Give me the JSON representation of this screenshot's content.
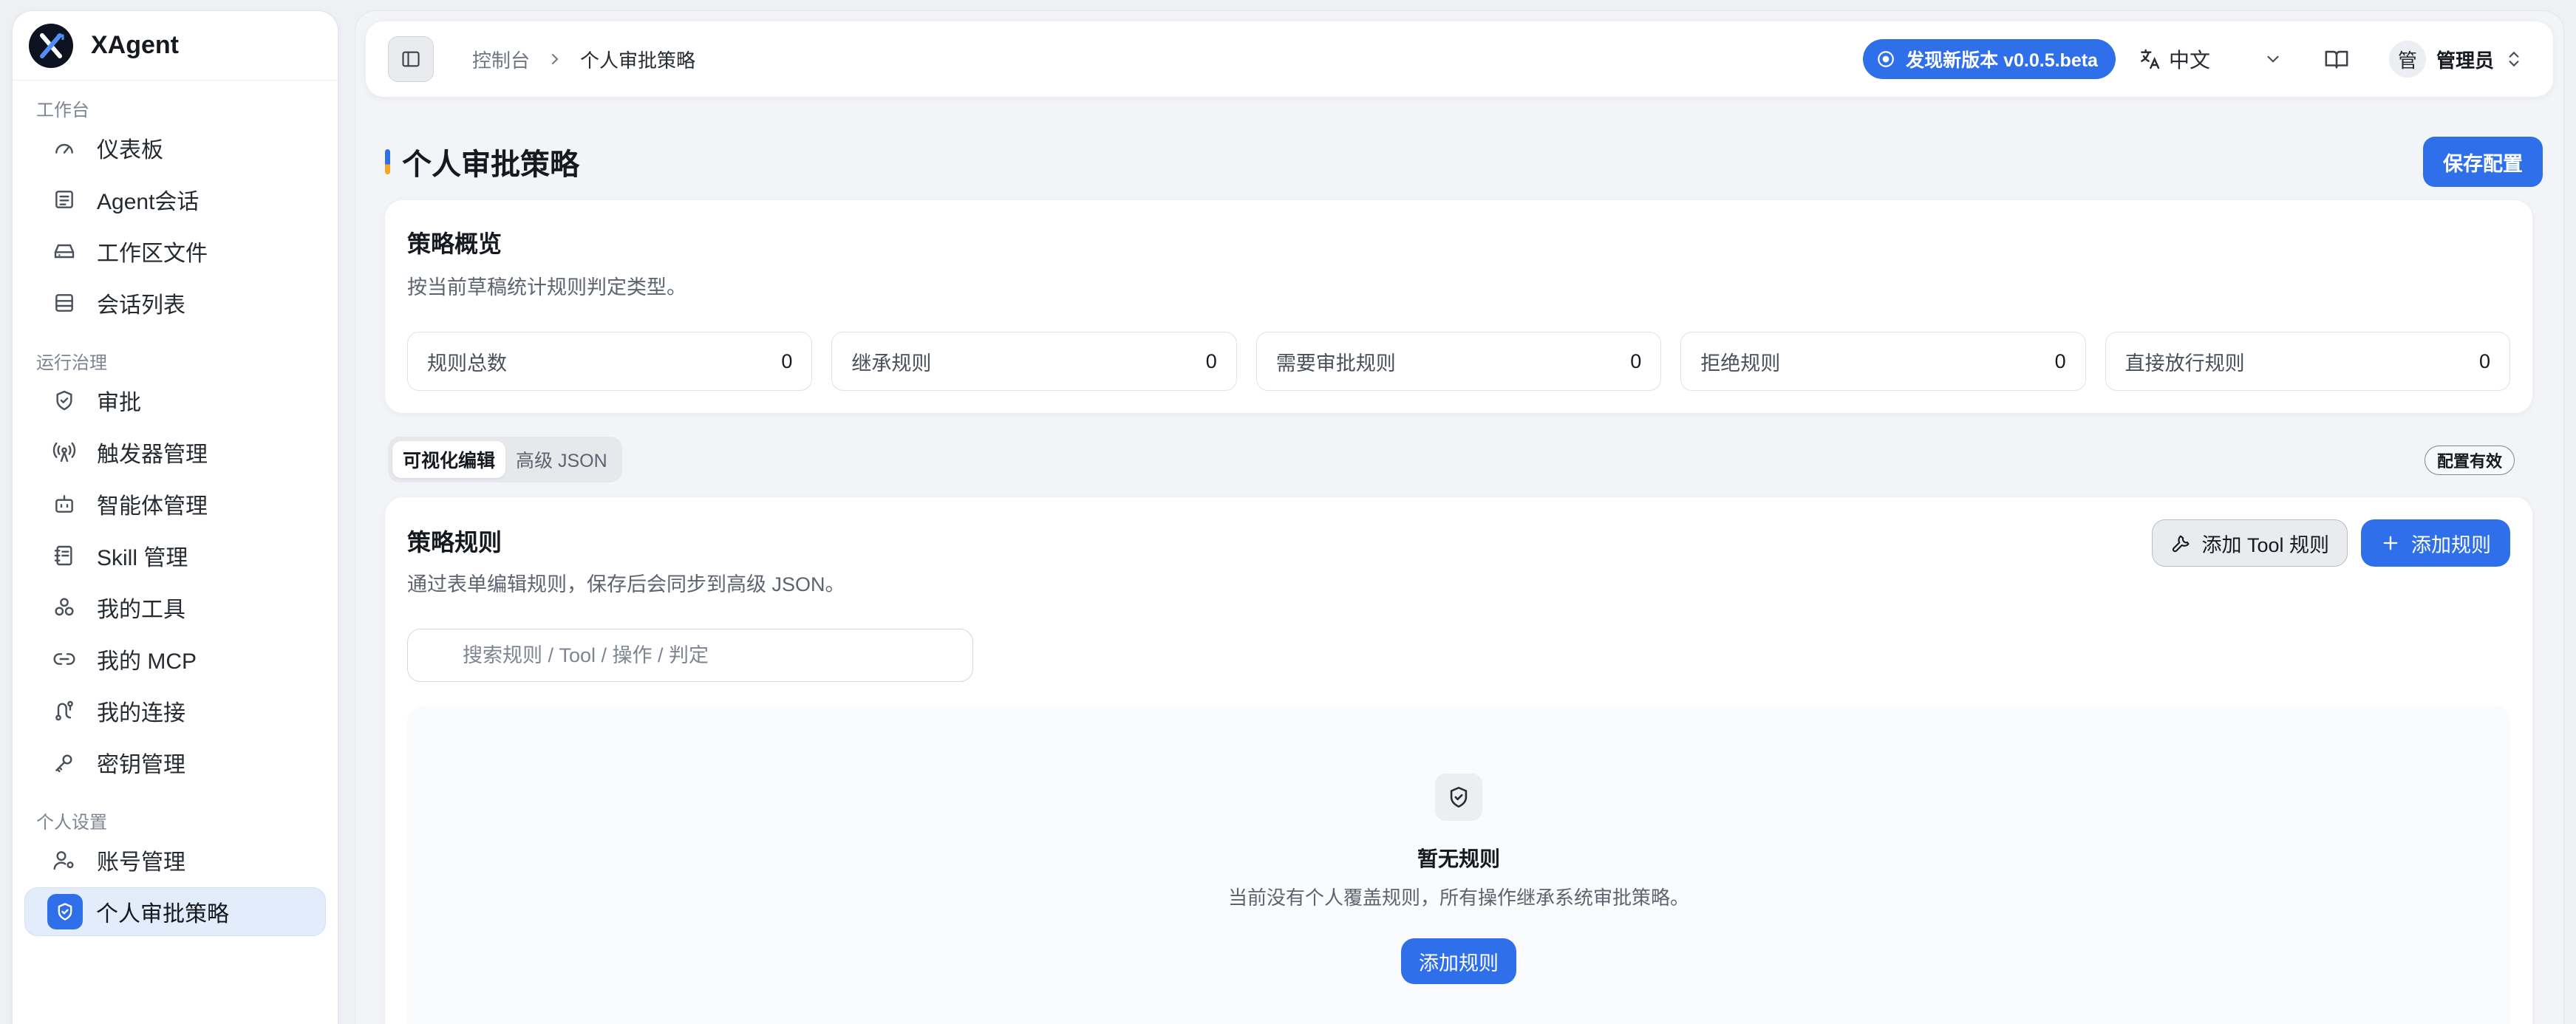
{
  "app": {
    "name": "XAgent"
  },
  "sidebar": {
    "sections": [
      {
        "label": "工作台"
      },
      {
        "label": "运行治理"
      },
      {
        "label": "个人设置"
      }
    ],
    "items": [
      {
        "label": "仪表板",
        "icon": "gauge-icon"
      },
      {
        "label": "Agent会话",
        "icon": "message-icon"
      },
      {
        "label": "工作区文件",
        "icon": "drive-icon"
      },
      {
        "label": "会话列表",
        "icon": "list-icon"
      },
      {
        "label": "审批",
        "icon": "shield-check-icon"
      },
      {
        "label": "触发器管理",
        "icon": "radio-tower-icon"
      },
      {
        "label": "智能体管理",
        "icon": "bot-icon"
      },
      {
        "label": "Skill 管理",
        "icon": "notebook-icon"
      },
      {
        "label": "我的工具",
        "icon": "cubes-icon"
      },
      {
        "label": "我的 MCP",
        "icon": "link-icon"
      },
      {
        "label": "我的连接",
        "icon": "route-icon"
      },
      {
        "label": "密钥管理",
        "icon": "key-icon"
      },
      {
        "label": "账号管理",
        "icon": "user-cog-icon"
      },
      {
        "label": "个人审批策略",
        "icon": "shield-check-icon",
        "active": true
      }
    ]
  },
  "topbar": {
    "breadcrumb": [
      "控制台",
      "个人审批策略"
    ],
    "version_label": "发现新版本 v0.0.5.beta",
    "language": "中文",
    "user_initial": "管",
    "user_name": "管理员"
  },
  "page": {
    "title": "个人审批策略",
    "save_label": "保存配置"
  },
  "overview": {
    "title": "策略概览",
    "subtitle": "按当前草稿统计规则判定类型。",
    "stats": [
      {
        "label": "规则总数",
        "value": "0"
      },
      {
        "label": "继承规则",
        "value": "0"
      },
      {
        "label": "需要审批规则",
        "value": "0"
      },
      {
        "label": "拒绝规则",
        "value": "0"
      },
      {
        "label": "直接放行规则",
        "value": "0"
      }
    ]
  },
  "tabs": [
    {
      "label": "可视化编辑",
      "active": true
    },
    {
      "label": "高级 JSON",
      "active": false
    }
  ],
  "status_badge": "配置有效",
  "rules": {
    "title": "策略规则",
    "subtitle": "通过表单编辑规则，保存后会同步到高级 JSON。",
    "add_tool_rule_label": "添加 Tool 规则",
    "add_rule_label": "添加规则",
    "search": {
      "placeholder": "搜索规则 / Tool / 操作 / 判定",
      "value": ""
    },
    "empty": {
      "title": "暂无规则",
      "subtitle": "当前没有个人覆盖规则，所有操作继承系统审批策略。",
      "button_label": "添加规则"
    }
  },
  "colors": {
    "accent": "#2f6fea",
    "active_nav_bg": "#e3ecfb",
    "background": "#f3f4f7"
  }
}
